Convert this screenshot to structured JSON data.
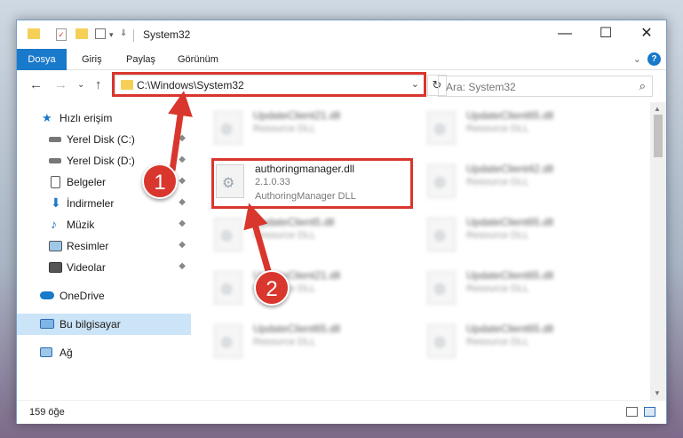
{
  "window": {
    "title": "System32",
    "controls": {
      "minimize": "—",
      "maximize": "☐",
      "close": "✕"
    }
  },
  "ribbon": {
    "tabs": [
      "Dosya",
      "Giriş",
      "Paylaş",
      "Görünüm"
    ],
    "expand": "⌄",
    "help": "?"
  },
  "nav": {
    "back": "←",
    "forward": "→",
    "recent": "⌄",
    "up": "↑",
    "address": "C:\\Windows\\System32",
    "address_dropdown": "⌄",
    "refresh": "↻",
    "search_placeholder": "Ara: System32",
    "search_icon": "⌕"
  },
  "sidebar": {
    "items": [
      {
        "label": "Hızlı erişim",
        "icon": "star-icon",
        "pinned": false
      },
      {
        "label": "Yerel Disk (C:)",
        "icon": "drive-icon",
        "pinned": true
      },
      {
        "label": "Yerel Disk (D:)",
        "icon": "drive-icon",
        "pinned": true
      },
      {
        "label": "Belgeler",
        "icon": "documents-icon",
        "pinned": true
      },
      {
        "label": "İndirmeler",
        "icon": "download-icon",
        "pinned": true
      },
      {
        "label": "Müzik",
        "icon": "music-icon",
        "pinned": true
      },
      {
        "label": "Resimler",
        "icon": "pictures-icon",
        "pinned": true
      },
      {
        "label": "Videolar",
        "icon": "videos-icon",
        "pinned": true
      },
      {
        "label": "OneDrive",
        "icon": "cloud-icon",
        "pinned": false
      },
      {
        "label": "Bu bilgisayar",
        "icon": "computer-icon",
        "pinned": false,
        "selected": true
      },
      {
        "label": "Ağ",
        "icon": "network-icon",
        "pinned": false
      }
    ],
    "pin_glyph": "📌"
  },
  "files": {
    "left_column": [
      {
        "name": "UpdateClient21.dll",
        "type": "Resource DLL"
      },
      {
        "name": "authoringmanager.dll",
        "version": "2.1.0.33",
        "type": "AuthoringManager DLL",
        "highlighted": true
      },
      {
        "name": "UpdateClient5.dll",
        "type": "Resource DLL"
      },
      {
        "name": "UpdateClient21.dll",
        "type": "Resource DLL"
      },
      {
        "name": "UpdateClient65.dll",
        "type": "Resource DLL"
      }
    ],
    "right_column": [
      {
        "name": "UpdateClient65.dll",
        "type": "Resource DLL"
      },
      {
        "name": "UpdateClient42.dll",
        "type": "Resource DLL"
      },
      {
        "name": "UpdateClient65.dll",
        "type": "Resource DLL"
      },
      {
        "name": "UpdateClient65.dll",
        "type": "Resource DLL"
      },
      {
        "name": "UpdateClient65.dll",
        "type": "Resource DLL"
      }
    ]
  },
  "status": {
    "count": "159 öğe"
  },
  "annotations": {
    "step1": "1",
    "step2": "2",
    "color": "#d9362e"
  }
}
